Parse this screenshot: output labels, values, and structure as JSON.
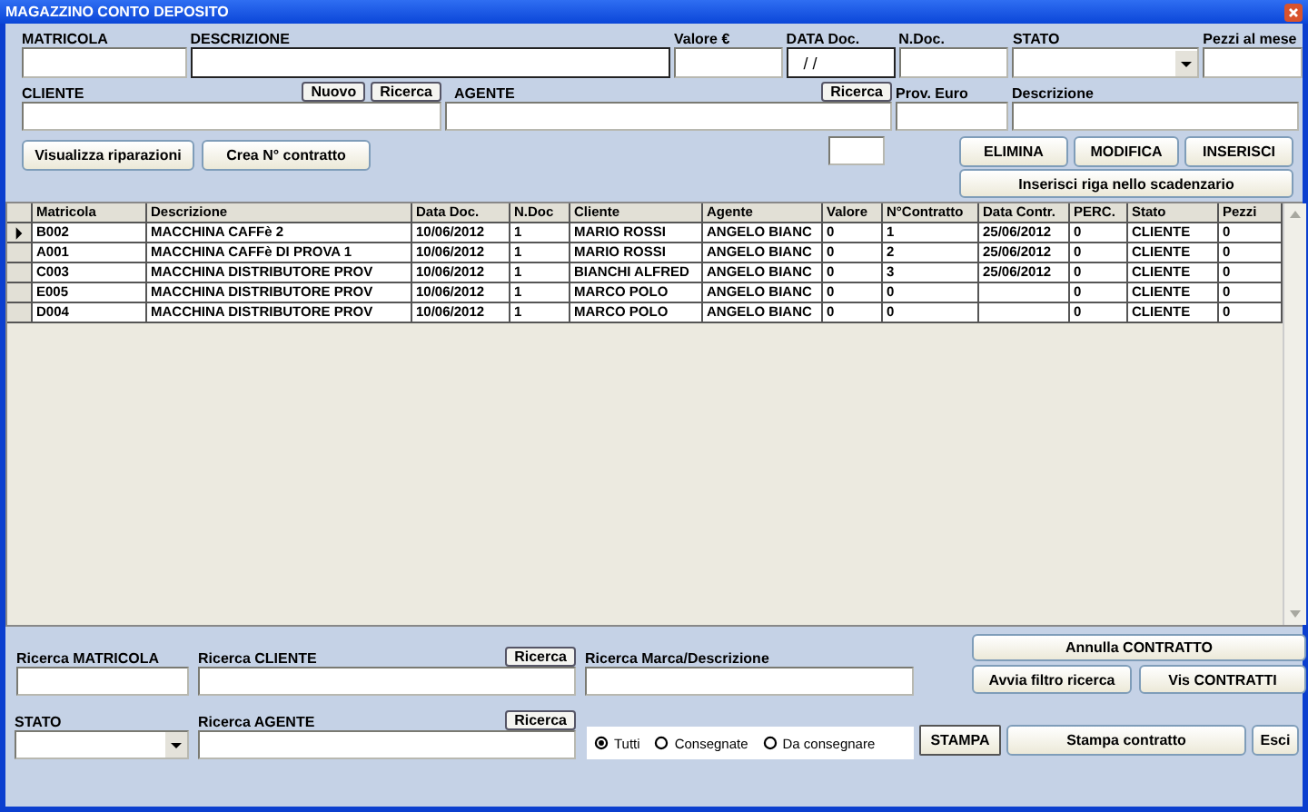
{
  "window": {
    "title": "MAGAZZINO CONTO DEPOSITO"
  },
  "row1": [
    {
      "label": "MATRICOLA",
      "kind": "text"
    },
    {
      "label": "DESCRIZIONE",
      "kind": "text"
    },
    {
      "label": "Valore €",
      "kind": "text"
    },
    {
      "label": "DATA Doc.",
      "kind": "text",
      "value": " / /"
    },
    {
      "label": "N.Doc.",
      "kind": "text"
    },
    {
      "label": "STATO",
      "kind": "select"
    },
    {
      "label": "Pezzi al mese",
      "kind": "text"
    }
  ],
  "row2": [
    {
      "label": "CLIENTE",
      "buttons": [
        "Nuovo",
        "Ricerca"
      ]
    },
    {
      "label": "AGENTE",
      "buttons": [
        "Ricerca"
      ]
    },
    {
      "label": "Prov. Euro"
    },
    {
      "label": "Descrizione"
    }
  ],
  "actions_left": [
    "Visualizza riparazioni",
    "Crea N° contratto"
  ],
  "actions_right": [
    "ELIMINA",
    "MODIFICA",
    "INSERISCI"
  ],
  "schedule_button": "Inserisci riga nello scadenzario",
  "table": {
    "columns": [
      "Matricola",
      "Descrizione",
      "Data Doc.",
      "N.Doc",
      "Cliente",
      "Agente",
      "Valore",
      "N°Contratto",
      "Data Contr.",
      "PERC.",
      "Stato",
      "Pezzi"
    ],
    "rows": [
      {
        "selected": true,
        "cells": [
          "B002",
          "MACCHINA CAFFè 2",
          "10/06/2012",
          "1",
          "MARIO ROSSI",
          "ANGELO BIANC",
          "0",
          "1",
          "25/06/2012",
          "0",
          "CLIENTE",
          "0"
        ]
      },
      {
        "selected": false,
        "cells": [
          "A001",
          "MACCHINA CAFFè DI PROVA 1",
          "10/06/2012",
          "1",
          "MARIO ROSSI",
          "ANGELO BIANC",
          "0",
          "2",
          "25/06/2012",
          "0",
          "CLIENTE",
          "0"
        ]
      },
      {
        "selected": false,
        "cells": [
          "C003",
          "MACCHINA DISTRIBUTORE PROV",
          "10/06/2012",
          "1",
          "BIANCHI ALFRED",
          "ANGELO BIANC",
          "0",
          "3",
          "25/06/2012",
          "0",
          "CLIENTE",
          "0"
        ]
      },
      {
        "selected": false,
        "cells": [
          "E005",
          "MACCHINA DISTRIBUTORE PROV",
          "10/06/2012",
          "1",
          "MARCO POLO",
          "ANGELO BIANC",
          "0",
          "0",
          "",
          "0",
          "CLIENTE",
          "0"
        ]
      },
      {
        "selected": false,
        "cells": [
          "D004",
          "MACCHINA DISTRIBUTORE PROV",
          "10/06/2012",
          "1",
          "MARCO POLO",
          "ANGELO BIANC",
          "0",
          "0",
          "",
          "0",
          "CLIENTE",
          "0"
        ]
      }
    ]
  },
  "search_row1": [
    {
      "label": "Ricerca MATRICOLA"
    },
    {
      "label": "Ricerca CLIENTE",
      "buttons": [
        "Ricerca"
      ]
    },
    {
      "label": "Ricerca Marca/Descrizione"
    }
  ],
  "search_row2": [
    {
      "label": "STATO",
      "kind": "select"
    },
    {
      "label": "Ricerca AGENTE",
      "kind": "text",
      "buttons": [
        "Ricerca"
      ]
    }
  ],
  "filter": [
    {
      "label": "Tutti",
      "selected": true
    },
    {
      "label": "Consegnate",
      "selected": false
    },
    {
      "label": "Da consegnare",
      "selected": false
    }
  ],
  "contract_buttons": {
    "cancel": "Annulla CONTRATTO",
    "filter": "Avvia filtro ricerca",
    "view": "Vis CONTRATTI"
  },
  "print_buttons": [
    "STAMPA",
    "Stampa contratto",
    "Esci"
  ]
}
